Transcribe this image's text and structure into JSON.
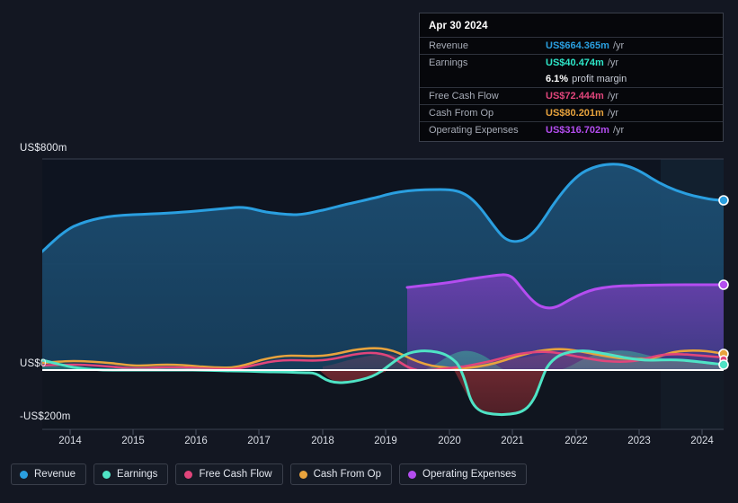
{
  "tooltip": {
    "date": "Apr 30 2024",
    "rows": [
      {
        "key": "Revenue",
        "value": "US$664.365m",
        "unit": "/yr",
        "color": "#2a9fe0"
      },
      {
        "key": "Earnings",
        "value": "US$40.474m",
        "unit": "/yr",
        "color": "#2ee6c8"
      },
      {
        "key": "",
        "value": "6.1%",
        "unit": "profit margin",
        "color": "#ffffff"
      },
      {
        "key": "Free Cash Flow",
        "value": "US$72.444m",
        "unit": "/yr",
        "color": "#e0457b"
      },
      {
        "key": "Cash From Op",
        "value": "US$80.201m",
        "unit": "/yr",
        "color": "#e8a33d"
      },
      {
        "key": "Operating Expenses",
        "value": "US$316.702m",
        "unit": "/yr",
        "color": "#b44df0"
      }
    ]
  },
  "legend": {
    "items": [
      {
        "label": "Revenue",
        "color": "#2a9fe0"
      },
      {
        "label": "Earnings",
        "color": "#4fe3c5"
      },
      {
        "label": "Free Cash Flow",
        "color": "#e0457b"
      },
      {
        "label": "Cash From Op",
        "color": "#e8a33d"
      },
      {
        "label": "Operating Expenses",
        "color": "#b44df0"
      }
    ]
  },
  "axes": {
    "y_ticks": [
      "US$800m",
      "US$0",
      "-US$200m"
    ],
    "x_ticks": [
      "2014",
      "2015",
      "2016",
      "2017",
      "2018",
      "2019",
      "2020",
      "2021",
      "2022",
      "2023",
      "2024"
    ]
  },
  "chart_data": {
    "type": "area",
    "title": "",
    "subtitle": "",
    "xlabel": "",
    "ylabel": "US$",
    "ylim": [
      -200,
      800
    ],
    "y_tick_values": [
      800,
      0,
      -200
    ],
    "grid": true,
    "legend_position": "bottom-left",
    "x": [
      "2013.5",
      "2014",
      "2014.5",
      "2015",
      "2015.5",
      "2016",
      "2016.5",
      "2017",
      "2017.5",
      "2018",
      "2018.5",
      "2019",
      "2019.5",
      "2020",
      "2020.5",
      "2021",
      "2021.5",
      "2022",
      "2022.5",
      "2023",
      "2023.5",
      "2024",
      "2024.4"
    ],
    "forecast_start": "2023.5",
    "units": "US$ millions",
    "series": [
      {
        "name": "Revenue",
        "color": "#2a9fe0",
        "values": [
          448,
          483,
          495,
          498,
          502,
          512,
          505,
          506,
          512,
          520,
          540,
          590,
          640,
          665,
          660,
          520,
          600,
          700,
          718,
          705,
          690,
          672,
          664.365
        ]
      },
      {
        "name": "Earnings",
        "color": "#4fe3c5",
        "values": [
          22,
          18,
          12,
          10,
          8,
          6,
          4,
          2,
          0,
          -28,
          -24,
          -20,
          30,
          38,
          10,
          -150,
          -150,
          55,
          60,
          50,
          45,
          42,
          40.474
        ]
      },
      {
        "name": "Free Cash Flow",
        "color": "#e0457b",
        "values": [
          14,
          12,
          10,
          8,
          6,
          5,
          4,
          10,
          20,
          24,
          36,
          40,
          20,
          5,
          14,
          18,
          52,
          62,
          48,
          40,
          60,
          68,
          72.444
        ]
      },
      {
        "name": "Cash From Op",
        "color": "#e8a33d",
        "values": [
          26,
          24,
          22,
          18,
          12,
          10,
          8,
          18,
          28,
          32,
          44,
          48,
          28,
          12,
          20,
          24,
          58,
          68,
          54,
          46,
          66,
          76,
          80.201
        ]
      },
      {
        "name": "Operating Expenses",
        "color": "#b44df0",
        "values": [
          null,
          null,
          null,
          null,
          null,
          null,
          null,
          null,
          null,
          null,
          null,
          null,
          322,
          330,
          338,
          300,
          292,
          310,
          316,
          316,
          316,
          316,
          316.702
        ]
      }
    ]
  }
}
